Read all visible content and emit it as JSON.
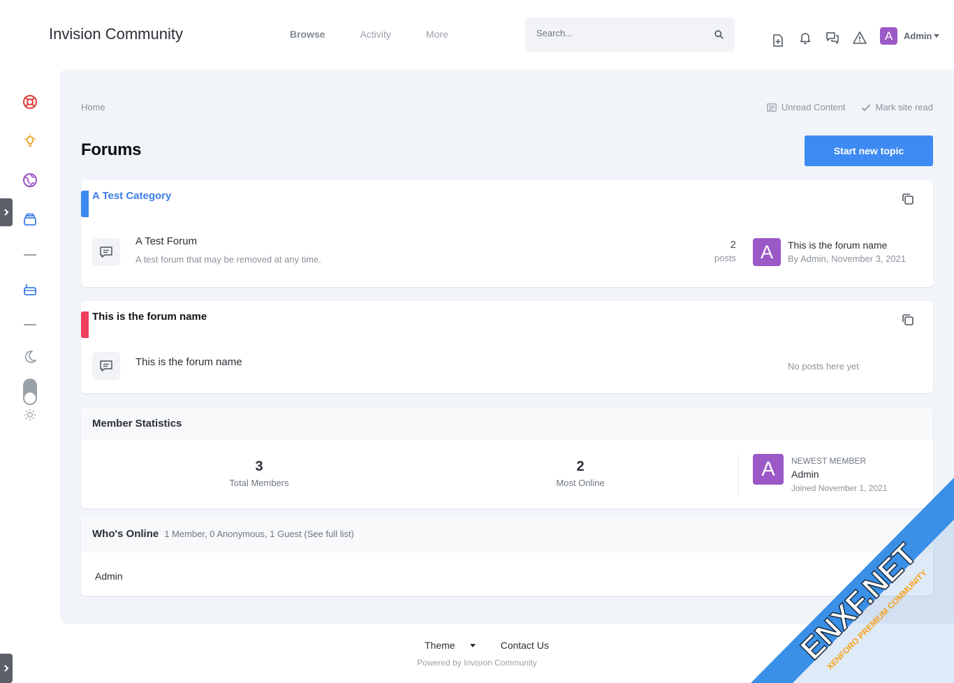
{
  "header": {
    "brand": "Invision Community",
    "nav": [
      {
        "label": "Browse"
      },
      {
        "label": "Activity"
      },
      {
        "label": "More"
      }
    ],
    "search_placeholder": "Search...",
    "user": {
      "initial": "A",
      "name": "Admin"
    }
  },
  "main": {
    "breadcrumb": "Home",
    "links": {
      "unread": "Unread Content",
      "mark_read": "Mark site read"
    },
    "title": "Forums",
    "new_topic": "Start new topic"
  },
  "categories": [
    {
      "title": "A Test Category",
      "color": "#3d8bf2",
      "title_color": "#3d7de4",
      "forum": {
        "name": "A Test Forum",
        "desc": "A test forum that may be removed at any time.",
        "post_count": "2",
        "post_label": "posts",
        "last_initial": "A",
        "last_title": "This is the forum name",
        "last_meta": "By Admin, November 3, 2021"
      }
    },
    {
      "title": "This is the forum name",
      "color": "#ee3e5d",
      "title_color": "#111318",
      "forum": {
        "name": "This is the forum name",
        "no_posts": "No posts here yet"
      }
    }
  ],
  "stats": {
    "title": "Member Statistics",
    "total_members": "3",
    "total_label": "Total Members",
    "most_online": "2",
    "most_label": "Most Online",
    "newest_label": "NEWEST MEMBER",
    "newest_initial": "A",
    "newest_name": "Admin",
    "newest_joined": "Joined November 1, 2021"
  },
  "online": {
    "title": "Who's Online",
    "summary": "1 Member, 0 Anonymous, 1 Guest (See full list)",
    "users": [
      "Admin"
    ]
  },
  "footer": {
    "theme": "Theme",
    "contact": "Contact Us",
    "powered": "Powered by Invision Community"
  },
  "watermark": {
    "main": "ENXF.NET",
    "sub": "XENFORO PREMIUM COMMUNITY"
  },
  "colors": {
    "accent": "#3d8bf2",
    "avatar": "#9b59c7",
    "panel": "#f1f4f9"
  }
}
